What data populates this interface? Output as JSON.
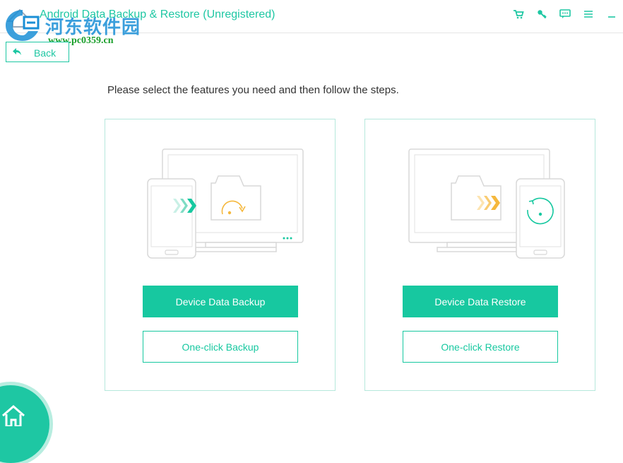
{
  "app": {
    "title": "Android Data Backup & Restore (Unregistered)"
  },
  "watermark": {
    "site_name": "河东软件园",
    "url": "www.pc0359.cn"
  },
  "toolbar": {
    "icons": [
      "cart-icon",
      "key-icon",
      "feedback-icon",
      "menu-icon",
      "minimize-icon"
    ]
  },
  "nav": {
    "back_label": "Back"
  },
  "main": {
    "instruction": "Please select the features you need and then follow the steps."
  },
  "panels": {
    "backup": {
      "primary_label": "Device Data Backup",
      "secondary_label": "One-click Backup"
    },
    "restore": {
      "primary_label": "Device Data Restore",
      "secondary_label": "One-click Restore"
    }
  },
  "colors": {
    "accent": "#1ec7a3",
    "panel_border": "#b6e8dc",
    "arrow_green": "#17c8a0",
    "arrow_orange": "#f5b83d",
    "device_stroke": "#d8d8d8"
  }
}
